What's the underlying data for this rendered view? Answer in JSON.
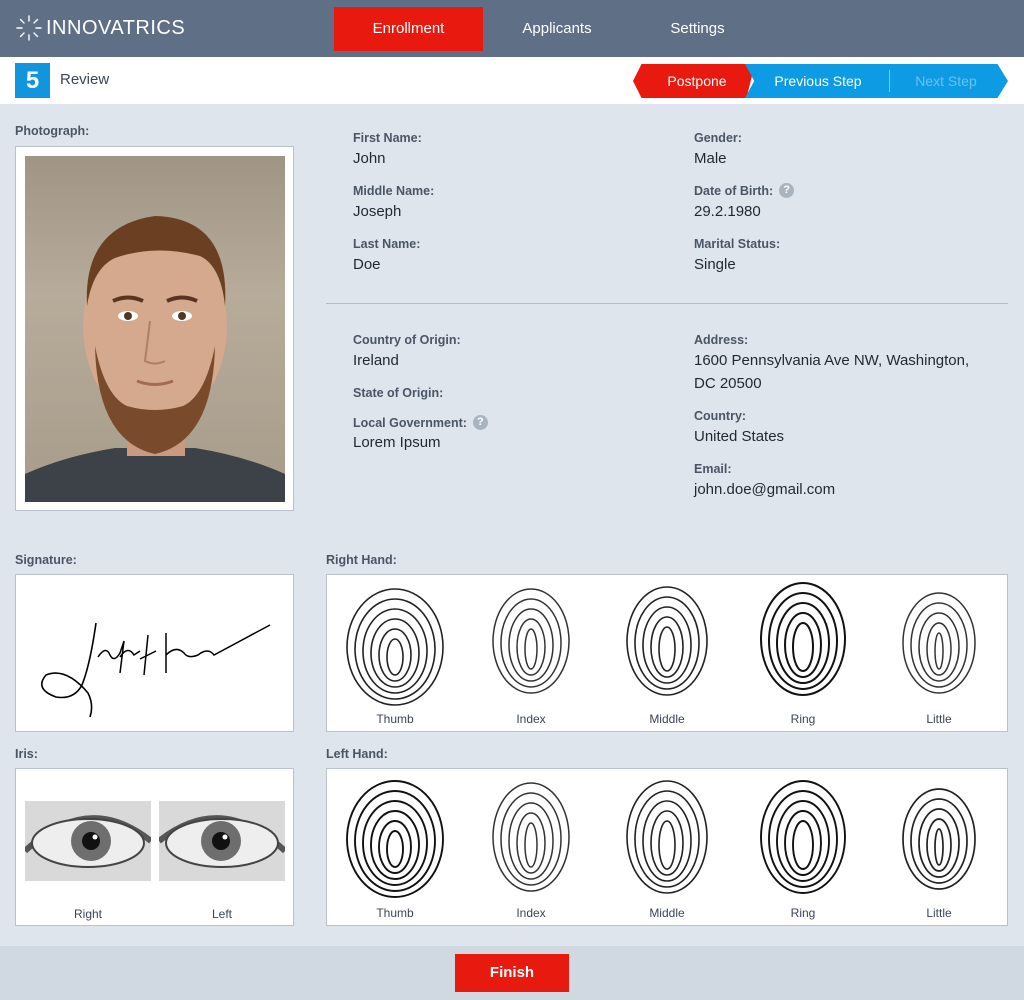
{
  "app": {
    "logo_text": "INNOVATRICS"
  },
  "nav": {
    "tabs": [
      {
        "label": "Enrollment",
        "active": true
      },
      {
        "label": "Applicants"
      },
      {
        "label": "Settings"
      }
    ]
  },
  "step": {
    "number": "5",
    "title": "Review"
  },
  "actions": {
    "postpone": "Postpone",
    "previous": "Previous Step",
    "next": "Next Step"
  },
  "labels": {
    "photograph": "Photograph:",
    "signature": "Signature:",
    "iris": "Iris:",
    "right_hand": "Right Hand:",
    "left_hand": "Left Hand:"
  },
  "personal": {
    "first_name": {
      "label": "First Name:",
      "value": "John"
    },
    "middle_name": {
      "label": "Middle Name:",
      "value": "Joseph"
    },
    "last_name": {
      "label": "Last Name:",
      "value": "Doe"
    },
    "gender": {
      "label": "Gender:",
      "value": "Male"
    },
    "dob": {
      "label": "Date of Birth:",
      "value": "29.2.1980"
    },
    "marital": {
      "label": "Marital Status:",
      "value": "Single"
    }
  },
  "origin": {
    "country": {
      "label": "Country of Origin:",
      "value": "Ireland"
    },
    "state": {
      "label": "State of Origin:",
      "value": ""
    },
    "local_gov": {
      "label": "Local Government:",
      "value": "Lorem Ipsum"
    },
    "address": {
      "label": "Address:",
      "line1": "1600 Pennsylvania Ave NW, Washington,",
      "line2": "DC 20500"
    },
    "country2": {
      "label": "Country:",
      "value": "United States"
    },
    "email": {
      "label": "Email:",
      "value": "john.doe@gmail.com"
    }
  },
  "fingers": [
    "Thumb",
    "Index",
    "Middle",
    "Ring",
    "Little"
  ],
  "iris": [
    "Right",
    "Left"
  ],
  "help_icon": "?",
  "footer": {
    "finish": "Finish"
  },
  "colors": {
    "nav_bg": "#5f6f86",
    "accent_red": "#e8190f",
    "accent_blue": "#0d9be3",
    "page_bg": "#dfe5ec"
  }
}
